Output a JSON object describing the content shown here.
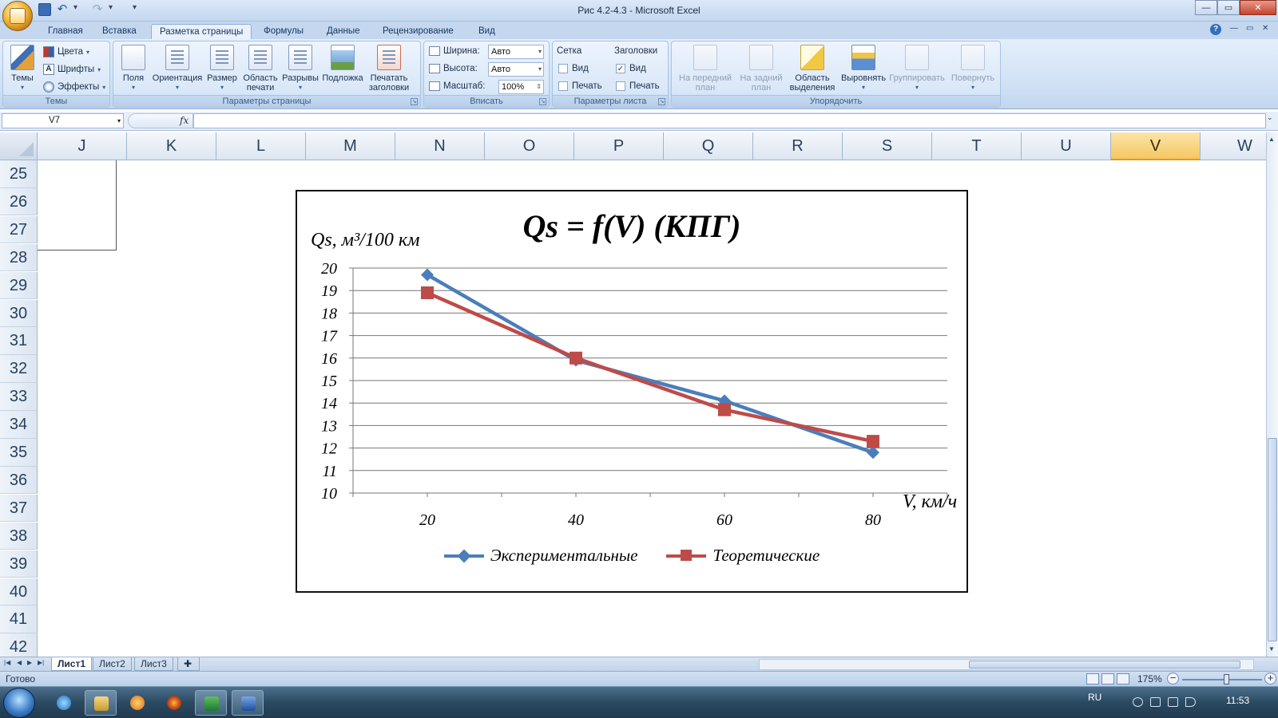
{
  "window": {
    "title": "Рис 4.2-4.3 - Microsoft Excel",
    "minimize_glyph": "—",
    "maximize_glyph": "▭",
    "close_glyph": "✕"
  },
  "ribbon_tabs": [
    "Главная",
    "Вставка",
    "Разметка страницы",
    "Формулы",
    "Данные",
    "Рецензирование",
    "Вид"
  ],
  "ribbon_active_tab": "Разметка страницы",
  "ribbon": {
    "themes_group": {
      "label": "Темы",
      "themes_btn": "Темы",
      "colors": "Цвета",
      "fonts": "Шрифты",
      "effects": "Эффекты"
    },
    "page_setup_group": {
      "label": "Параметры страницы",
      "margins": "Поля",
      "orientation": "Ориентация",
      "size": "Размер",
      "print_area_1": "Область",
      "print_area_2": "печати",
      "breaks": "Разрывы",
      "background": "Подложка",
      "print_titles_1": "Печатать",
      "print_titles_2": "заголовки"
    },
    "scale_group": {
      "label": "Вписать",
      "width_label": "Ширина:",
      "width_value": "Авто",
      "height_label": "Высота:",
      "height_value": "Авто",
      "scale_label": "Масштаб:",
      "scale_value": "100%"
    },
    "sheet_options_group": {
      "label": "Параметры листа",
      "gridlines_title": "Сетка",
      "headings_title": "Заголовки",
      "view": "Вид",
      "print": "Печать",
      "gridlines_view_checked": false,
      "gridlines_print_checked": false,
      "headings_view_checked": true,
      "headings_print_checked": false
    },
    "arrange_group": {
      "label": "Упорядочить",
      "bring_front_1": "На передний",
      "bring_front_2": "план",
      "send_back_1": "На задний",
      "send_back_2": "план",
      "selection_1": "Область",
      "selection_2": "выделения",
      "align": "Выровнять",
      "group": "Группировать",
      "rotate": "Повернуть"
    }
  },
  "formula_bar": {
    "name_box": "V7",
    "fx": "fx",
    "formula": ""
  },
  "grid": {
    "columns": [
      "J",
      "K",
      "L",
      "M",
      "N",
      "O",
      "P",
      "Q",
      "R",
      "S",
      "T",
      "U",
      "V",
      "W"
    ],
    "selected_column": "V",
    "rows": [
      "25",
      "26",
      "27",
      "28",
      "29",
      "30",
      "31",
      "32",
      "33",
      "34",
      "35",
      "36",
      "37",
      "38",
      "39",
      "40",
      "41",
      "42"
    ]
  },
  "chart_data": {
    "type": "line",
    "title": "Qs = f(V) (КПГ)",
    "ylabel": "Qs, м³/100 км",
    "xlabel": "V, км/ч",
    "categories": [
      20,
      40,
      60,
      80
    ],
    "ylim": [
      10,
      20
    ],
    "yticks": [
      10,
      11,
      12,
      13,
      14,
      15,
      16,
      17,
      18,
      19,
      20
    ],
    "grid": true,
    "legend_position": "bottom",
    "series": [
      {
        "name": "Экспериментальные",
        "values": [
          19.7,
          15.9,
          14.1,
          11.8
        ],
        "color": "#4a7ebb",
        "marker": "diamond"
      },
      {
        "name": "Теоретические",
        "values": [
          18.9,
          16.0,
          13.7,
          12.3
        ],
        "color": "#be4b48",
        "marker": "square"
      }
    ]
  },
  "sheet_tabs": [
    "Лист1",
    "Лист2",
    "Лист3"
  ],
  "active_sheet": "Лист1",
  "status": {
    "ready": "Готово",
    "zoom": "175%",
    "zoom_minus": "−",
    "zoom_plus": "+"
  },
  "taskbar": {
    "language": "RU",
    "time": "11:53"
  }
}
